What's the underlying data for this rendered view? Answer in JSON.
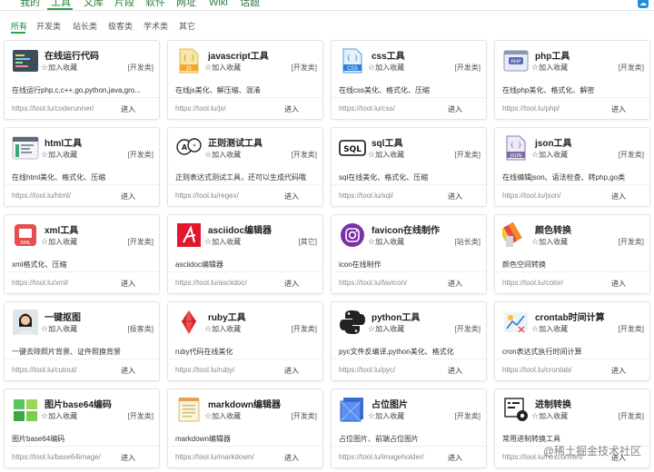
{
  "nav": {
    "items": [
      "我的",
      "工具",
      "文库",
      "片段",
      "软件",
      "网址",
      "Wiki",
      "话题"
    ],
    "active_index": 1
  },
  "filters": {
    "items": [
      "所有",
      "开发类",
      "站长类",
      "极客类",
      "学术类",
      "其它"
    ],
    "active_index": 0
  },
  "fav_label": "加入收藏",
  "enter_label": "进入",
  "cards": [
    {
      "title": "在线运行代码",
      "category": "[开发类]",
      "desc": "在线运行php,c,c++,go,python,java,gro...",
      "url": "https://tool.lu/coderunner/",
      "icon": "code-runner-icon"
    },
    {
      "title": "javascript工具",
      "category": "[开发类]",
      "desc": "在线js美化、解压缩、混淆",
      "url": "https://tool.lu/js/",
      "icon": "js-file-icon",
      "icon_text": "JS"
    },
    {
      "title": "css工具",
      "category": "[开发类]",
      "desc": "在线css美化、格式化、压缩",
      "url": "https://tool.lu/css/",
      "icon": "css-file-icon",
      "icon_text": "CSS"
    },
    {
      "title": "php工具",
      "category": "[开发类]",
      "desc": "在线php美化、格式化、解密",
      "url": "https://tool.lu/php/",
      "icon": "php-window-icon",
      "icon_text": "PHP"
    },
    {
      "title": "html工具",
      "category": "[开发类]",
      "desc": "在线html美化、格式化、压缩",
      "url": "https://tool.lu/html/",
      "icon": "html-code-icon"
    },
    {
      "title": "正则测试工具",
      "category": "[开发类]",
      "desc": "正则表达式测试工具，还可以生成代码哦",
      "url": "https://tool.lu/regex/",
      "icon": "regex-bubbles-icon"
    },
    {
      "title": "sql工具",
      "category": "[开发类]",
      "desc": "sql在线美化、格式化、压缩",
      "url": "https://tool.lu/sql/",
      "icon": "sql-box-icon",
      "icon_text": "SQL"
    },
    {
      "title": "json工具",
      "category": "[开发类]",
      "desc": "在线编辑json、语法检查、转php,go类",
      "url": "https://tool.lu/json/",
      "icon": "json-file-icon",
      "icon_text": "JSON"
    },
    {
      "title": "xml工具",
      "category": "[开发类]",
      "desc": "xml格式化、压缩",
      "url": "https://tool.lu/xml/",
      "icon": "xml-file-icon",
      "icon_text": "XML"
    },
    {
      "title": "asciidoc编辑器",
      "category": "[其它]",
      "desc": "asciidoc编辑器",
      "url": "https://tool.lu/asciidoc/",
      "icon": "asciidoc-logo-icon"
    },
    {
      "title": "favicon在线制作",
      "category": "[站长类]",
      "desc": "icon在线制作",
      "url": "https://tool.lu/favicon/",
      "icon": "instagram-camera-icon"
    },
    {
      "title": "颜色转换",
      "category": "[开发类]",
      "desc": "颜色空间转换",
      "url": "https://tool.lu/color/",
      "icon": "color-swatch-icon"
    },
    {
      "title": "一键抠图",
      "category": "[极客类]",
      "desc": "一键去除照片背景、证件照换背景",
      "url": "https://tool.lu/cutout/",
      "icon": "portrait-photo-icon"
    },
    {
      "title": "ruby工具",
      "category": "[开发类]",
      "desc": "ruby代码在线美化",
      "url": "https://tool.lu/ruby/",
      "icon": "ruby-gem-icon"
    },
    {
      "title": "python工具",
      "category": "[开发类]",
      "desc": "pyc文件反编译,python美化、格式化",
      "url": "https://tool.lu/pyc/",
      "icon": "python-logo-icon"
    },
    {
      "title": "crontab时间计算",
      "category": "[开发类]",
      "desc": "cron表达式执行时间计算",
      "url": "https://tool.lu/crontab/",
      "icon": "crontab-chart-icon"
    },
    {
      "title": "图片base64编码",
      "category": "[开发类]",
      "desc": "图片base64编码",
      "url": "https://tool.lu/base64image/",
      "icon": "image-mosaic-icon"
    },
    {
      "title": "markdown编辑器",
      "category": "[开发类]",
      "desc": "markdown编辑器",
      "url": "https://tool.lu/markdown/",
      "icon": "notepad-icon"
    },
    {
      "title": "占位图片",
      "category": "[开发类]",
      "desc": "占位图片、前端占位图片",
      "url": "https://tool.lu/imageholder/",
      "icon": "placeholder-image-icon"
    },
    {
      "title": "进制转换",
      "category": "[开发类]",
      "desc": "常用进制转换工具",
      "url": "https://tool.lu/hexconvert/",
      "icon": "binary-gear-icon"
    }
  ],
  "watermark": "@稀土掘金技术社区"
}
